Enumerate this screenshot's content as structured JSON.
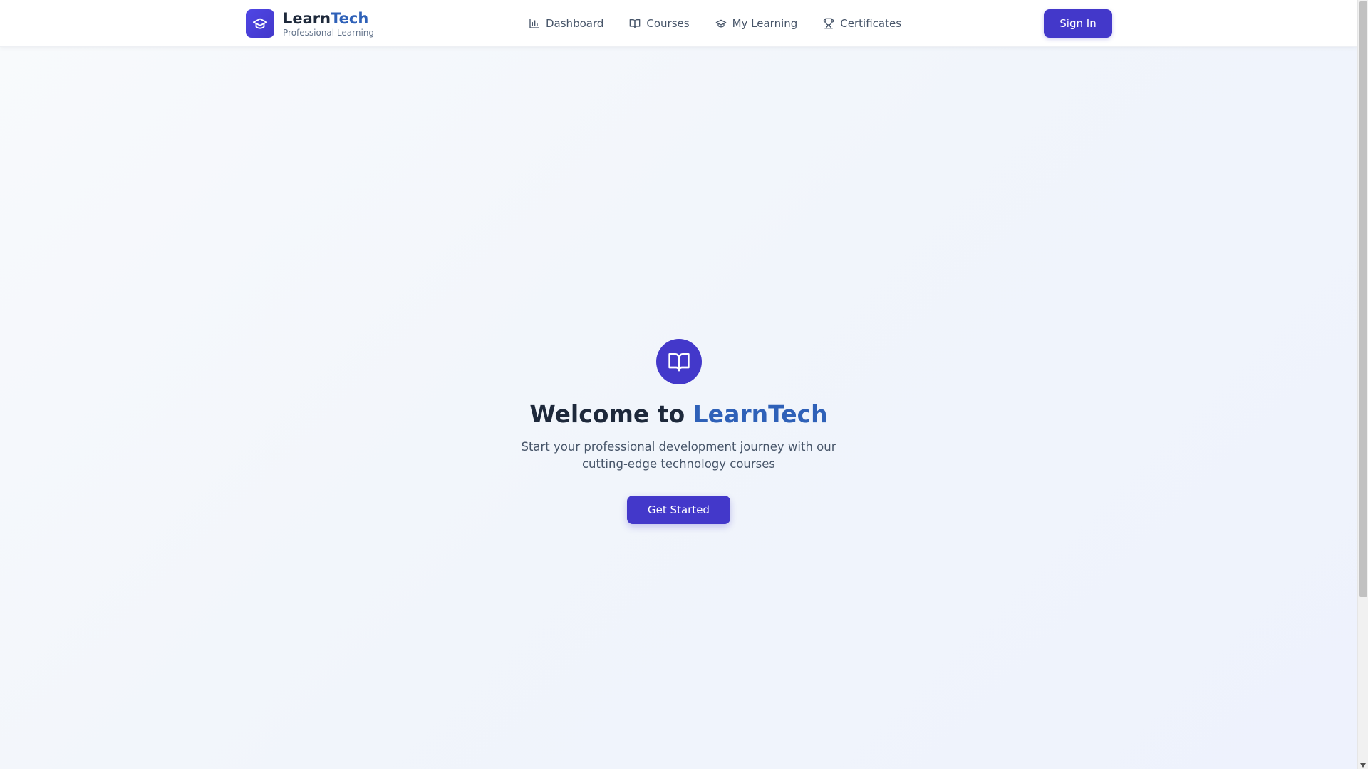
{
  "header": {
    "brand_part1": "Learn",
    "brand_part2": "Tech",
    "tagline": "Professional Learning",
    "logo_icon": "graduation-cap-icon",
    "nav": [
      {
        "label": "Dashboard",
        "icon": "bar-chart-icon"
      },
      {
        "label": "Courses",
        "icon": "book-open-icon"
      },
      {
        "label": "My Learning",
        "icon": "graduation-cap-icon"
      },
      {
        "label": "Certificates",
        "icon": "trophy-icon"
      }
    ],
    "signin_label": "Sign In"
  },
  "hero": {
    "icon": "book-open-icon",
    "title_part1": "Welcome to ",
    "title_part2": "LearnTech",
    "subtitle": "Start your professional development journey with our cutting-edge technology courses",
    "cta_label": "Get Started"
  },
  "colors": {
    "primary": "#4338ca",
    "brand_accent": "#2f61b8",
    "heading": "#1e293b",
    "muted": "#475569"
  }
}
